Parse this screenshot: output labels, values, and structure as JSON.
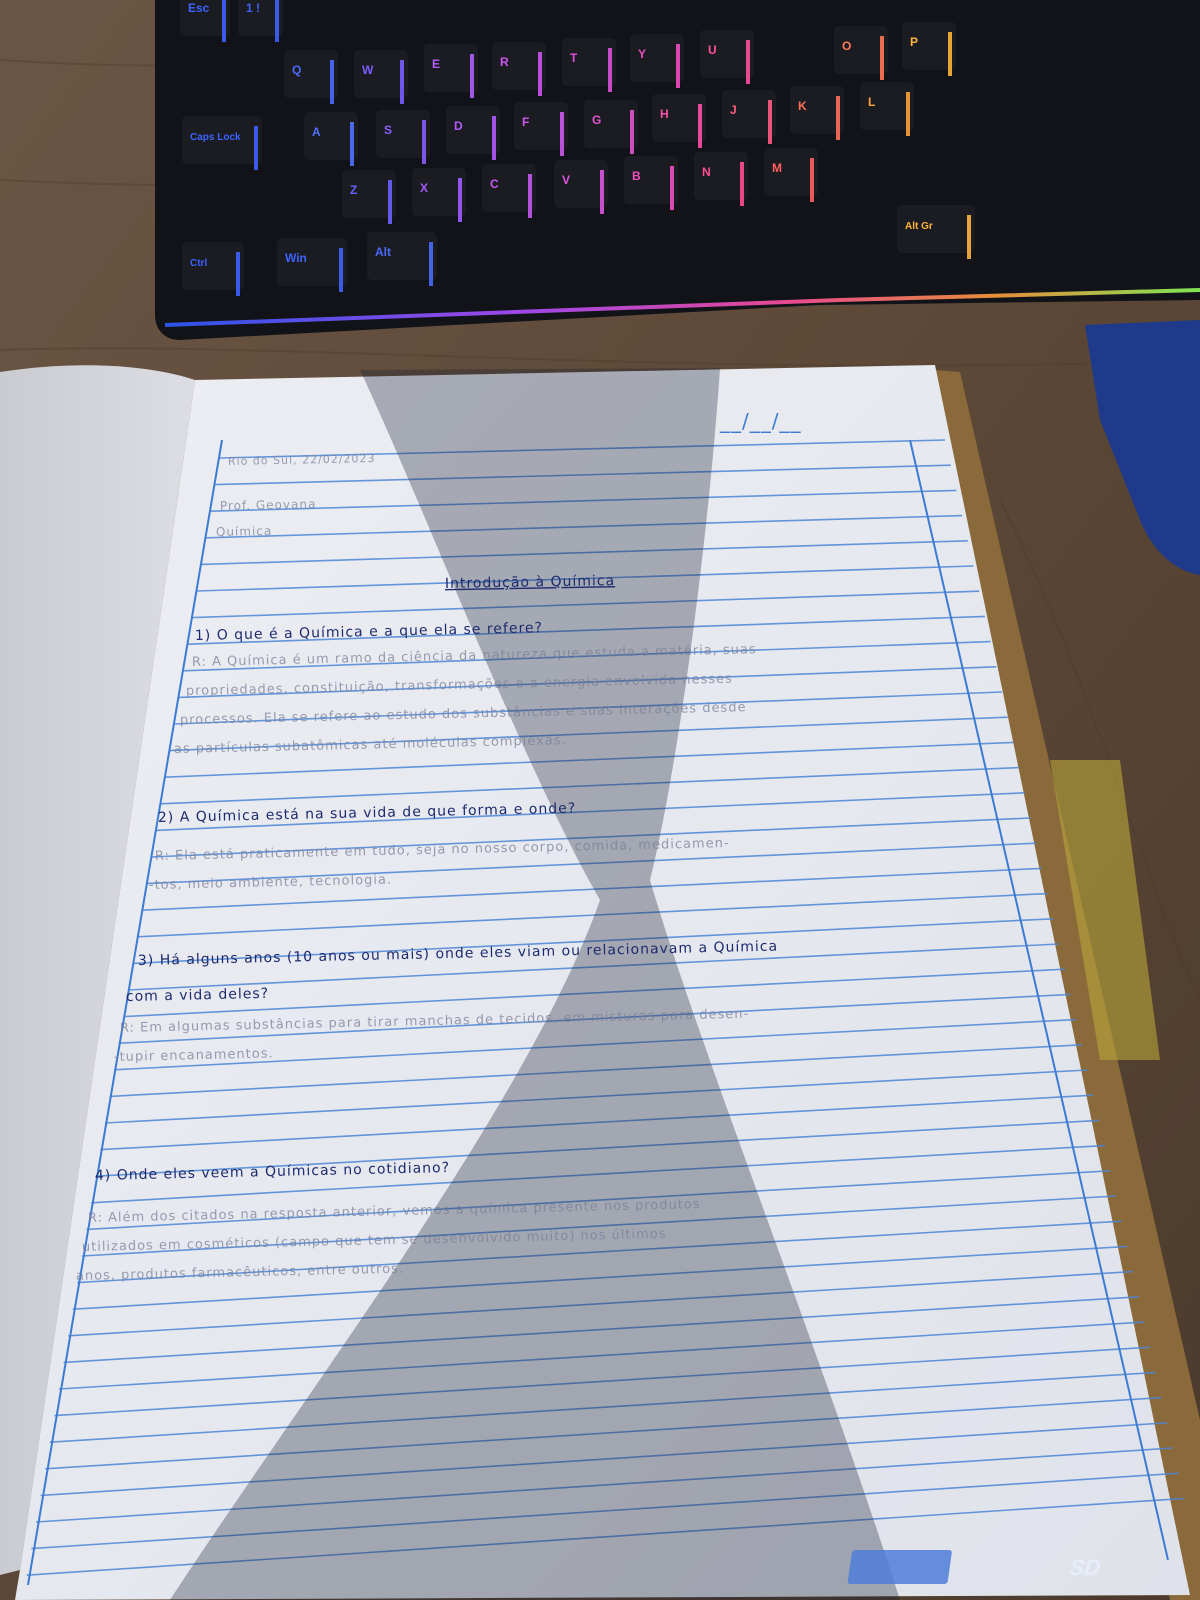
{
  "keyboard": {
    "keys": [
      {
        "label": "Esc",
        "color": "#3d63ff"
      },
      {
        "label": "1 !",
        "color": "#3d63ff"
      },
      {
        "label": "Q",
        "color": "#4a6bff"
      },
      {
        "label": "W",
        "color": "#7a5dff"
      },
      {
        "label": "E",
        "color": "#b45cff"
      },
      {
        "label": "R",
        "color": "#cc55f0"
      },
      {
        "label": "T",
        "color": "#dd4fd8"
      },
      {
        "label": "Y",
        "color": "#ee4cc0"
      },
      {
        "label": "U",
        "color": "#ff4fa0"
      },
      {
        "label": "O",
        "color": "#ff7a55"
      },
      {
        "label": "P",
        "color": "#ffb53a"
      },
      {
        "label": "A",
        "color": "#5270ff"
      },
      {
        "label": "S",
        "color": "#8a5cff"
      },
      {
        "label": "D",
        "color": "#b35aff"
      },
      {
        "label": "F",
        "color": "#d257f0"
      },
      {
        "label": "G",
        "color": "#e453d0"
      },
      {
        "label": "H",
        "color": "#ff4fa8"
      },
      {
        "label": "J",
        "color": "#ff5c80"
      },
      {
        "label": "K",
        "color": "#ff6f5a"
      },
      {
        "label": "L",
        "color": "#ffa03a"
      },
      {
        "label": "Z",
        "color": "#6a62ff"
      },
      {
        "label": "X",
        "color": "#a25cff"
      },
      {
        "label": "C",
        "color": "#c858f0"
      },
      {
        "label": "V",
        "color": "#db55e0"
      },
      {
        "label": "B",
        "color": "#ef50c0"
      },
      {
        "label": "N",
        "color": "#ff4f90"
      },
      {
        "label": "M",
        "color": "#ff6060"
      },
      {
        "label": "Caps Lock",
        "color": "#3d63ff"
      },
      {
        "label": "Ctrl",
        "color": "#3d63ff"
      },
      {
        "label": "Win",
        "color": "#3d63ff"
      },
      {
        "label": "Alt",
        "color": "#4a6bff"
      },
      {
        "label": "Alt Gr",
        "color": "#ffb53a"
      }
    ]
  },
  "notebook": {
    "date_marks": "__/__/__",
    "header": {
      "place_date": "Rio do Sul, 22/02/2023",
      "teacher": "Prof. Geovana",
      "subject": "Química"
    },
    "title": "Introdução à Química",
    "qa": [
      {
        "question": [
          "1) O que é a Química e a que ela se refere?"
        ],
        "answer": [
          "R: A Química é um ramo da ciência da natureza que estuda a matéria, suas",
          "propriedades, constituição, transformações e a energia envolvida nesses",
          "processos. Ela se refere ao estudo dos substâncias e suas interações desde",
          "as partículas subatômicas até moléculas complexas."
        ]
      },
      {
        "question": [
          "2) A Química está na sua vida de que forma e onde?"
        ],
        "answer": [
          "R: Ela está praticamente em tudo, seja no nosso corpo, comida, medicamen-",
          "-tos, meio ambiente, tecnologia."
        ]
      },
      {
        "question": [
          "3) Há alguns anos (10 anos ou mais) onde eles viam ou relacionavam a Química",
          "com a vida deles?"
        ],
        "answer": [
          "R: Em algumas substâncias para tirar manchas de tecidos, em misturas para desen-",
          "-tupir encanamentos."
        ]
      },
      {
        "question": [
          "4) Onde eles veem a Químicas no cotidiano?"
        ],
        "answer": [
          "R: Além dos citados na resposta anterior, vemos a química presente nos produtos",
          "utilizados em cosméticos (campo que tem se desenvolvido muito) nos últimos",
          "anos, produtos farmacêuticos, entre outros."
        ]
      }
    ],
    "brand": "SD"
  }
}
